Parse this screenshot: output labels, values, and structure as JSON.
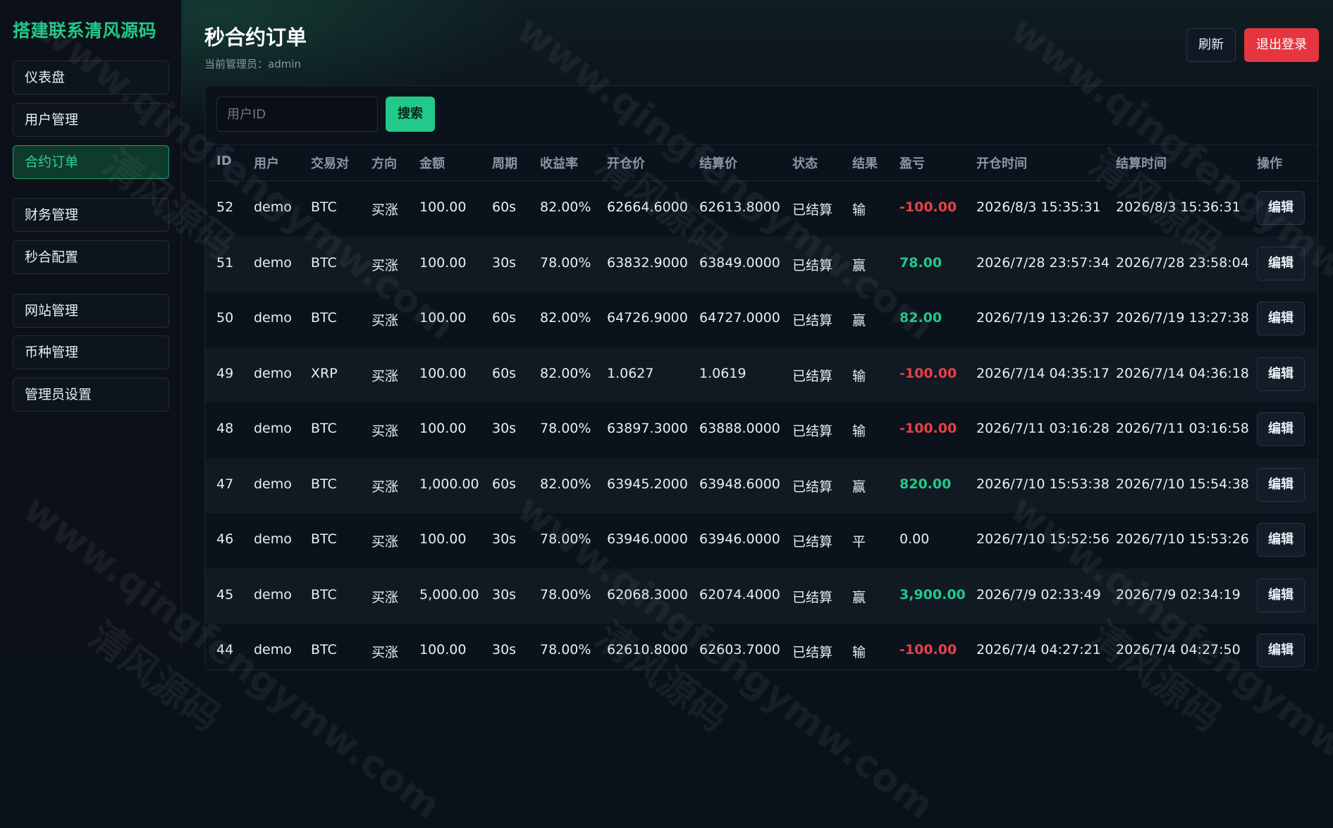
{
  "brand": "搭建联系清风源码",
  "sidebar": {
    "items": [
      {
        "label": "仪表盘",
        "active": false
      },
      {
        "label": "用户管理",
        "active": false
      },
      {
        "label": "合约订单",
        "active": true
      },
      {
        "label": "财务管理",
        "active": false
      },
      {
        "label": "秒合配置",
        "active": false
      },
      {
        "label": "网站管理",
        "active": false
      },
      {
        "label": "币种管理",
        "active": false
      },
      {
        "label": "管理员设置",
        "active": false
      }
    ]
  },
  "header": {
    "title": "秒合约订单",
    "subtitle": "当前管理员：admin",
    "refresh_label": "刷新",
    "logout_label": "退出登录"
  },
  "search": {
    "placeholder": "用户ID",
    "button_label": "搜索"
  },
  "table": {
    "columns": [
      "ID",
      "用户",
      "交易对",
      "方向",
      "金额",
      "周期",
      "收益率",
      "开仓价",
      "结算价",
      "状态",
      "结果",
      "盈亏",
      "开仓时间",
      "结算时间",
      "操作"
    ],
    "edit_label": "编辑",
    "rows": [
      {
        "id": "52",
        "user": "demo",
        "pair": "BTC",
        "direction": "买涨",
        "amount": "100.00",
        "period": "60s",
        "rate": "82.00%",
        "open_price": "62664.6000",
        "settle_price": "62613.8000",
        "status": "已结算",
        "result": "输",
        "pnl": "-100.00",
        "pnl_type": "neg",
        "open_time": "2026/8/3 15:35:31",
        "settle_time": "2026/8/3 15:36:31"
      },
      {
        "id": "51",
        "user": "demo",
        "pair": "BTC",
        "direction": "买涨",
        "amount": "100.00",
        "period": "30s",
        "rate": "78.00%",
        "open_price": "63832.9000",
        "settle_price": "63849.0000",
        "status": "已结算",
        "result": "赢",
        "pnl": "78.00",
        "pnl_type": "pos",
        "open_time": "2026/7/28 23:57:34",
        "settle_time": "2026/7/28 23:58:04"
      },
      {
        "id": "50",
        "user": "demo",
        "pair": "BTC",
        "direction": "买涨",
        "amount": "100.00",
        "period": "60s",
        "rate": "82.00%",
        "open_price": "64726.9000",
        "settle_price": "64727.0000",
        "status": "已结算",
        "result": "赢",
        "pnl": "82.00",
        "pnl_type": "pos",
        "open_time": "2026/7/19 13:26:37",
        "settle_time": "2026/7/19 13:27:38"
      },
      {
        "id": "49",
        "user": "demo",
        "pair": "XRP",
        "direction": "买涨",
        "amount": "100.00",
        "period": "60s",
        "rate": "82.00%",
        "open_price": "1.0627",
        "settle_price": "1.0619",
        "status": "已结算",
        "result": "输",
        "pnl": "-100.00",
        "pnl_type": "neg",
        "open_time": "2026/7/14 04:35:17",
        "settle_time": "2026/7/14 04:36:18"
      },
      {
        "id": "48",
        "user": "demo",
        "pair": "BTC",
        "direction": "买涨",
        "amount": "100.00",
        "period": "30s",
        "rate": "78.00%",
        "open_price": "63897.3000",
        "settle_price": "63888.0000",
        "status": "已结算",
        "result": "输",
        "pnl": "-100.00",
        "pnl_type": "neg",
        "open_time": "2026/7/11 03:16:28",
        "settle_time": "2026/7/11 03:16:58"
      },
      {
        "id": "47",
        "user": "demo",
        "pair": "BTC",
        "direction": "买涨",
        "amount": "1,000.00",
        "period": "60s",
        "rate": "82.00%",
        "open_price": "63945.2000",
        "settle_price": "63948.6000",
        "status": "已结算",
        "result": "赢",
        "pnl": "820.00",
        "pnl_type": "pos",
        "open_time": "2026/7/10 15:53:38",
        "settle_time": "2026/7/10 15:54:38"
      },
      {
        "id": "46",
        "user": "demo",
        "pair": "BTC",
        "direction": "买涨",
        "amount": "100.00",
        "period": "30s",
        "rate": "78.00%",
        "open_price": "63946.0000",
        "settle_price": "63946.0000",
        "status": "已结算",
        "result": "平",
        "pnl": "0.00",
        "pnl_type": "zero",
        "open_time": "2026/7/10 15:52:56",
        "settle_time": "2026/7/10 15:53:26"
      },
      {
        "id": "45",
        "user": "demo",
        "pair": "BTC",
        "direction": "买涨",
        "amount": "5,000.00",
        "period": "30s",
        "rate": "78.00%",
        "open_price": "62068.3000",
        "settle_price": "62074.4000",
        "status": "已结算",
        "result": "赢",
        "pnl": "3,900.00",
        "pnl_type": "pos",
        "open_time": "2026/7/9 02:33:49",
        "settle_time": "2026/7/9 02:34:19"
      },
      {
        "id": "44",
        "user": "demo",
        "pair": "BTC",
        "direction": "买涨",
        "amount": "100.00",
        "period": "30s",
        "rate": "78.00%",
        "open_price": "62610.8000",
        "settle_price": "62603.7000",
        "status": "已结算",
        "result": "输",
        "pnl": "-100.00",
        "pnl_type": "neg",
        "open_time": "2026/7/4 04:27:21",
        "settle_time": "2026/7/4 04:27:50"
      }
    ]
  },
  "watermark": {
    "url_text": "www.qingfengymw.com",
    "cn_text": "清风源码"
  },
  "colors": {
    "accent": "#22c98a",
    "danger": "#e5363f",
    "loss": "#e5414a",
    "background": "#0b111a"
  }
}
